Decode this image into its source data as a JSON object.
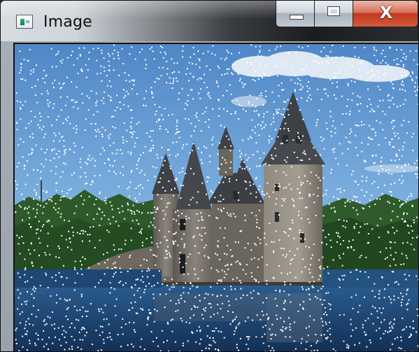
{
  "window": {
    "title": "Image",
    "controls": {
      "minimize_icon": "minimize-icon",
      "maximize_icon": "maximize-icon",
      "close_label": "X"
    }
  },
  "image": {
    "subject": "castle-tower-on-water",
    "noise": "salt-noise"
  },
  "colors": {
    "sky_top": "#4f86c6",
    "sky_bottom": "#aed3ee",
    "stone": "#6f6a63",
    "roof": "#3e4146",
    "trees": "#2f5a2b",
    "water": "#173a64",
    "close_red": "#c2391e"
  }
}
